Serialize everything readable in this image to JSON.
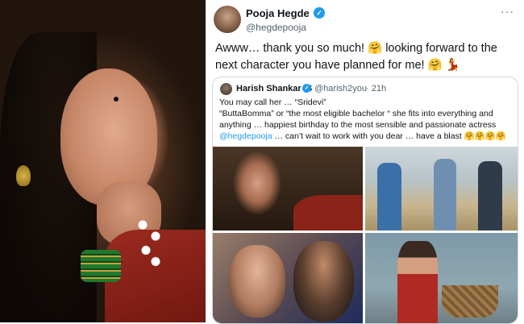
{
  "tweet": {
    "author_name": "Pooja Hegde",
    "author_handle": "@hegdepooja",
    "verified_mark": "✓",
    "more_menu": "···",
    "text": "Awww… thank you so much! 🤗 looking forward to the next character you have planned for me! 🤗 💃"
  },
  "quoted_tweet": {
    "author_name": "Harish Shankar .S",
    "verified_mark": "✓",
    "author_handle": "@harish2you",
    "time": "· 21h",
    "text_lines": [
      "You may call her … “Sridevi”",
      "“ButtaBomma” or “the most eligible bachelor “ she fits into everything and",
      "anything … happiest birthday to the most sensible and passionate actress",
      "… can’t wait to work with you dear … have a blast 🤗🤗🤗🤗"
    ],
    "mention": "@hegdepooja",
    "media_count": 4
  },
  "icons": [
    "avatar",
    "verified-badge-icon",
    "more-icon"
  ],
  "colors": {
    "accent": "#1d9bf0",
    "text": "#0f1419",
    "muted": "#536471",
    "border": "#cfd9de"
  }
}
